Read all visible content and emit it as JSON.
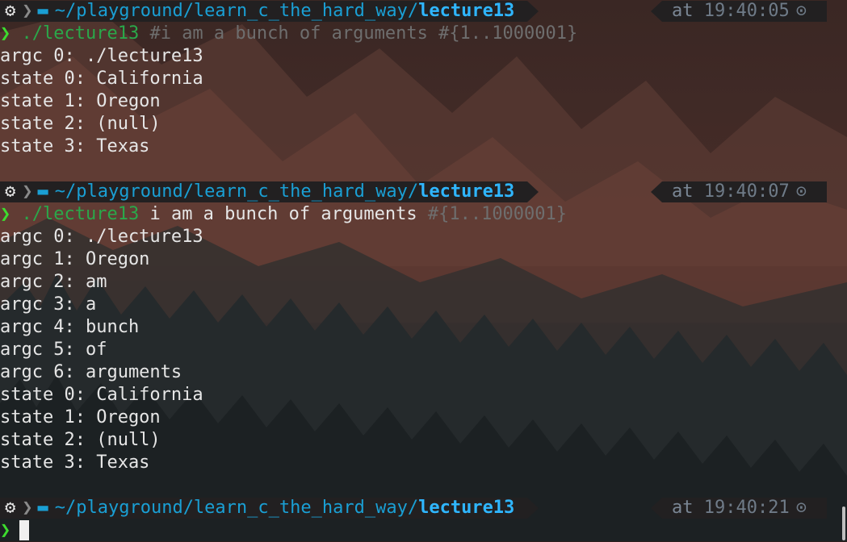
{
  "prompts": [
    {
      "path_prefix": "~/playground/learn_c_the_hard_way/",
      "path_dir": "lecture13",
      "at_label": "at",
      "time": "19:40:05"
    },
    {
      "path_prefix": "~/playground/learn_c_the_hard_way/",
      "path_dir": "lecture13",
      "at_label": "at",
      "time": "19:40:07"
    },
    {
      "path_prefix": "~/playground/learn_c_the_hard_way/",
      "path_dir": "lecture13",
      "at_label": "at",
      "time": "19:40:21"
    }
  ],
  "icons": {
    "os": "linux-os-icon",
    "separator": "chevron-right-icon",
    "folder": "folder-icon",
    "clock": "clock-icon",
    "prompt": "prompt-chevron-icon"
  },
  "commands": [
    {
      "chevron": "❯",
      "program": "./lecture13",
      "args": "",
      "comment": "#i am a bunch of arguments #{1..1000001}"
    },
    {
      "chevron": "❯",
      "program": "./lecture13",
      "args": "i am a bunch of arguments",
      "comment": "#{1..1000001}"
    }
  ],
  "output1": [
    "argc 0: ./lecture13",
    "state 0: California",
    "state 1: Oregon",
    "state 2: (null)",
    "state 3: Texas"
  ],
  "output2": [
    "argc 0: ./lecture13",
    "argc 1: Oregon",
    "argc 2: am",
    "argc 3: a",
    "argc 4: bunch",
    "argc 5: of",
    "argc 6: arguments",
    "state 0: California",
    "state 1: Oregon",
    "state 2: (null)",
    "state 3: Texas"
  ],
  "current_prompt": {
    "chevron": "❯"
  },
  "colors": {
    "path": "#1a9fd4",
    "path_dir": "#2fb6ff",
    "prompt_chevron": "#3ddc2f",
    "command": "#2aa84a",
    "comment": "#6e6e6e",
    "segment_bg": "#222021"
  }
}
